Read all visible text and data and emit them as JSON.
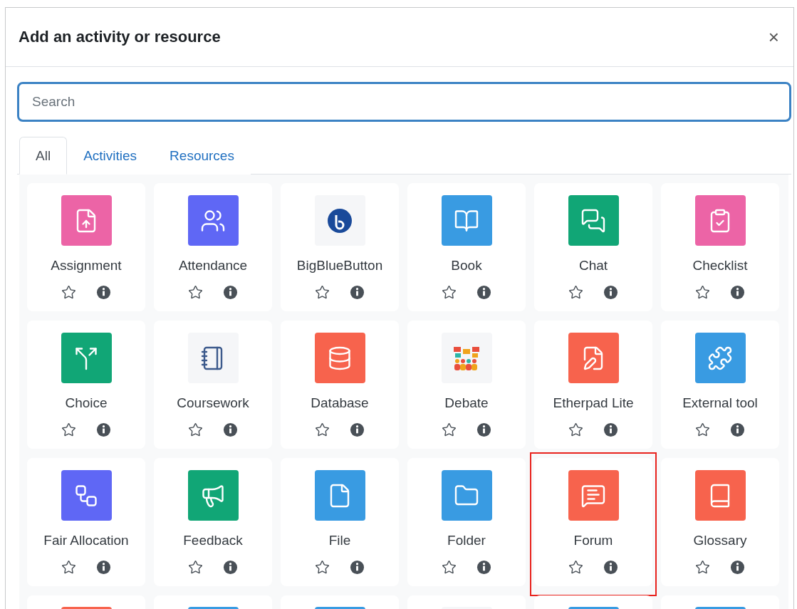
{
  "dialog": {
    "title": "Add an activity or resource",
    "close": "×"
  },
  "search": {
    "placeholder": "Search"
  },
  "tabs": [
    {
      "label": "All",
      "selected": true
    },
    {
      "label": "Activities",
      "selected": false
    },
    {
      "label": "Resources",
      "selected": false
    }
  ],
  "modules": [
    {
      "name": "Assignment",
      "kind": "assignment",
      "color": "#ec64a6",
      "highlighted": false
    },
    {
      "name": "Attendance",
      "kind": "attendance",
      "color": "#5f67f5",
      "highlighted": false
    },
    {
      "name": "BigBlueButton",
      "kind": "bigbluebutton",
      "color": "#f5f6f8",
      "highlighted": false
    },
    {
      "name": "Book",
      "kind": "book",
      "color": "#399be2",
      "highlighted": false
    },
    {
      "name": "Chat",
      "kind": "chat",
      "color": "#11a676",
      "highlighted": false
    },
    {
      "name": "Checklist",
      "kind": "checklist",
      "color": "#ec64a6",
      "highlighted": false
    },
    {
      "name": "Choice",
      "kind": "choice",
      "color": "#11a676",
      "highlighted": false
    },
    {
      "name": "Coursework",
      "kind": "coursework",
      "color": "#f5f6f8",
      "highlighted": false
    },
    {
      "name": "Database",
      "kind": "database",
      "color": "#f7634d",
      "highlighted": false
    },
    {
      "name": "Debate",
      "kind": "debate",
      "color": "#f5f6f8",
      "highlighted": false
    },
    {
      "name": "Etherpad Lite",
      "kind": "etherpad",
      "color": "#f7634d",
      "highlighted": false
    },
    {
      "name": "External tool",
      "kind": "puzzle",
      "color": "#399be2",
      "highlighted": false
    },
    {
      "name": "Fair Allocation",
      "kind": "allocation",
      "color": "#5f67f5",
      "highlighted": false
    },
    {
      "name": "Feedback",
      "kind": "feedback",
      "color": "#11a676",
      "highlighted": false
    },
    {
      "name": "File",
      "kind": "file",
      "color": "#399be2",
      "highlighted": false
    },
    {
      "name": "Folder",
      "kind": "folder",
      "color": "#399be2",
      "highlighted": false
    },
    {
      "name": "Forum",
      "kind": "forum",
      "color": "#f7634d",
      "highlighted": true
    },
    {
      "name": "Glossary",
      "kind": "glossary",
      "color": "#f7634d",
      "highlighted": false
    }
  ],
  "partial_row": [
    {
      "color": "#f7634d"
    },
    {
      "color": "#399be2"
    },
    {
      "color": "#399be2"
    },
    {
      "color": "#f5f6f8"
    },
    {
      "color": "#399be2"
    },
    {
      "color": "#399be2"
    }
  ]
}
